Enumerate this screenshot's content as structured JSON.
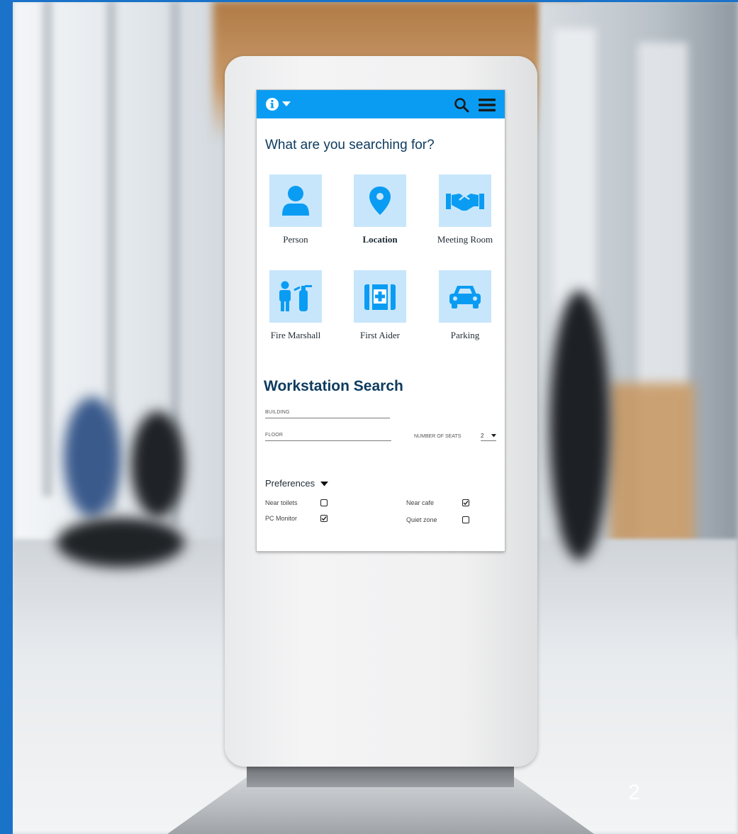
{
  "slide": {
    "page_number": "2"
  },
  "app_bar": {
    "color": "#0a9cf3",
    "left_icon": "info-circle-icon",
    "right_icons": [
      "search-icon",
      "hamburger-menu-icon"
    ]
  },
  "search_section": {
    "title": "What are you searching for?",
    "tiles": [
      {
        "label": "Person",
        "icon": "person-icon"
      },
      {
        "label": "Location",
        "icon": "map-pin-icon"
      },
      {
        "label": "Meeting Room",
        "icon": "handshake-icon"
      },
      {
        "label": "Fire Marshall",
        "icon": "fire-extinguisher-icon"
      },
      {
        "label": "First Aider",
        "icon": "first-aid-kit-icon"
      },
      {
        "label": "Parking",
        "icon": "car-icon"
      }
    ]
  },
  "workstation": {
    "title": "Workstation Search",
    "building_placeholder": "BUILDING",
    "floor_placeholder": "FLOOR",
    "seats_label": "NUMBER OF SEATS",
    "seats_value": "2"
  },
  "preferences": {
    "title": "Preferences",
    "items": [
      {
        "label": "Near toilets",
        "checked": false
      },
      {
        "label": "Near cafe",
        "checked": true
      },
      {
        "label": "PC Monitor",
        "checked": true
      },
      {
        "label": "Quiet zone",
        "checked": false
      }
    ]
  },
  "colors": {
    "tile_bg": "#c8e6fb",
    "icon": "#0a9cf3",
    "heading": "#0e3b60"
  }
}
